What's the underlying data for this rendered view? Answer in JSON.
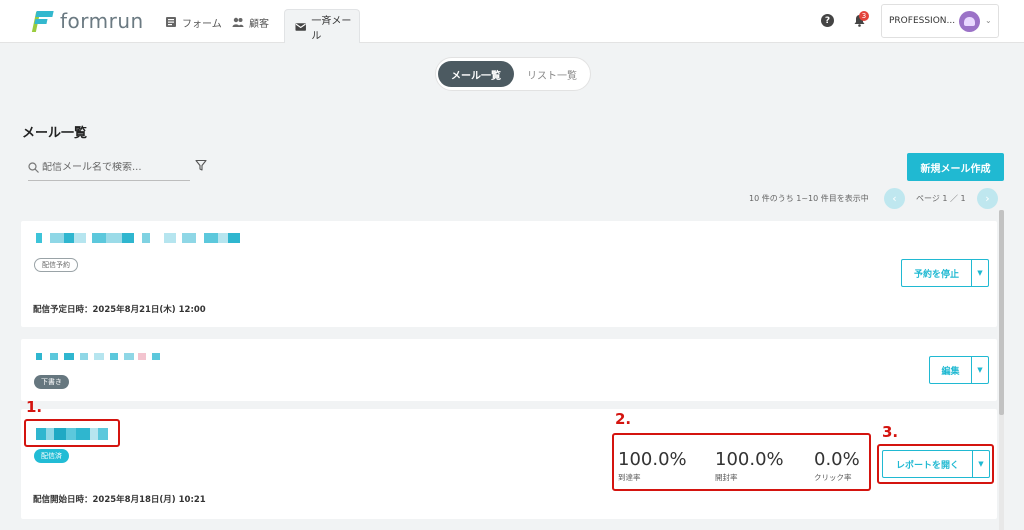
{
  "header": {
    "logo_text": "formrun",
    "nav": {
      "forms": "フォーム",
      "customers": "顧客",
      "mail": "一斉メール"
    },
    "help": "?",
    "notification_count": "3",
    "account_name": "PROFESSION..."
  },
  "toggle": {
    "active": "メール一覧",
    "inactive": "リスト一覧"
  },
  "page_title": "メール一覧",
  "search": {
    "placeholder": "配信メール名で検索..."
  },
  "create_button": "新規メール作成",
  "pagination": {
    "summary": "10 件のうち 1~10 件目を表示中",
    "indicator": "ページ 1 ／ 1",
    "prev": "‹",
    "next": "›"
  },
  "mails": [
    {
      "badge": "配信予約",
      "meta": "配信予定日時：2025年8月21日(木) 12:00",
      "action": "予約を停止"
    },
    {
      "badge": "下書き",
      "action": "編集"
    },
    {
      "badge": "配信済",
      "meta": "配信開始日時：2025年8月18日(月) 10:21",
      "stats": [
        {
          "value": "100.0%",
          "label": "到達率"
        },
        {
          "value": "100.0%",
          "label": "開封率"
        },
        {
          "value": "0.0%",
          "label": "クリック率"
        }
      ],
      "action": "レポートを開く"
    }
  ],
  "annotations": [
    "1.",
    "2.",
    "3."
  ],
  "colors": {
    "accent": "#20b9d2",
    "annotation": "#d4140f",
    "toggle_active": "#4c5a61"
  }
}
